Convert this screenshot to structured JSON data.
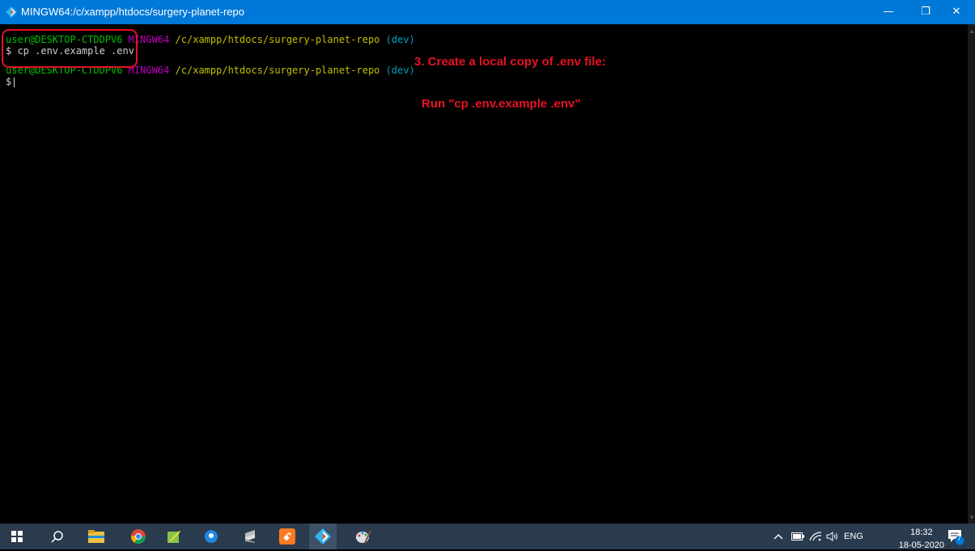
{
  "window": {
    "title": "MINGW64:/c/xampp/htdocs/surgery-planet-repo",
    "minimize": "—",
    "maximize": "❐",
    "close": "✕"
  },
  "terminal": {
    "prompt1": {
      "user": "user@DESKTOP-CTDDPV6",
      "env": "MINGW64",
      "path": "/c/xampp/htdocs/surgery-planet-repo",
      "branch": "(dev)"
    },
    "command": "$ cp .env.example .env",
    "prompt2": {
      "user": "user@DESKTOP-CTDDPV6",
      "env": "MINGW64",
      "path": "/c/xampp/htdocs/surgery-planet-repo",
      "branch": "(dev)"
    },
    "prompt_symbol": "$"
  },
  "annotations": {
    "step_title": "3. Create a local copy of .env file:",
    "step_instruction": "Run \"cp .env.example .env\""
  },
  "taskbar": {
    "icons": [
      "windows-start-icon",
      "search-icon",
      "file-explorer-icon",
      "chrome-icon",
      "notepad-plus-plus-icon",
      "maps-icon",
      "sublime-text-icon",
      "xampp-icon",
      "git-bash-icon",
      "paint-icon"
    ],
    "tray": {
      "language": "ENG",
      "time": "18:32",
      "date": "18-05-2020",
      "notification_count": "7"
    }
  },
  "colors": {
    "titlebar": "#0078d7",
    "taskbar": "#2a3b4e",
    "annotation": "#e81123"
  }
}
